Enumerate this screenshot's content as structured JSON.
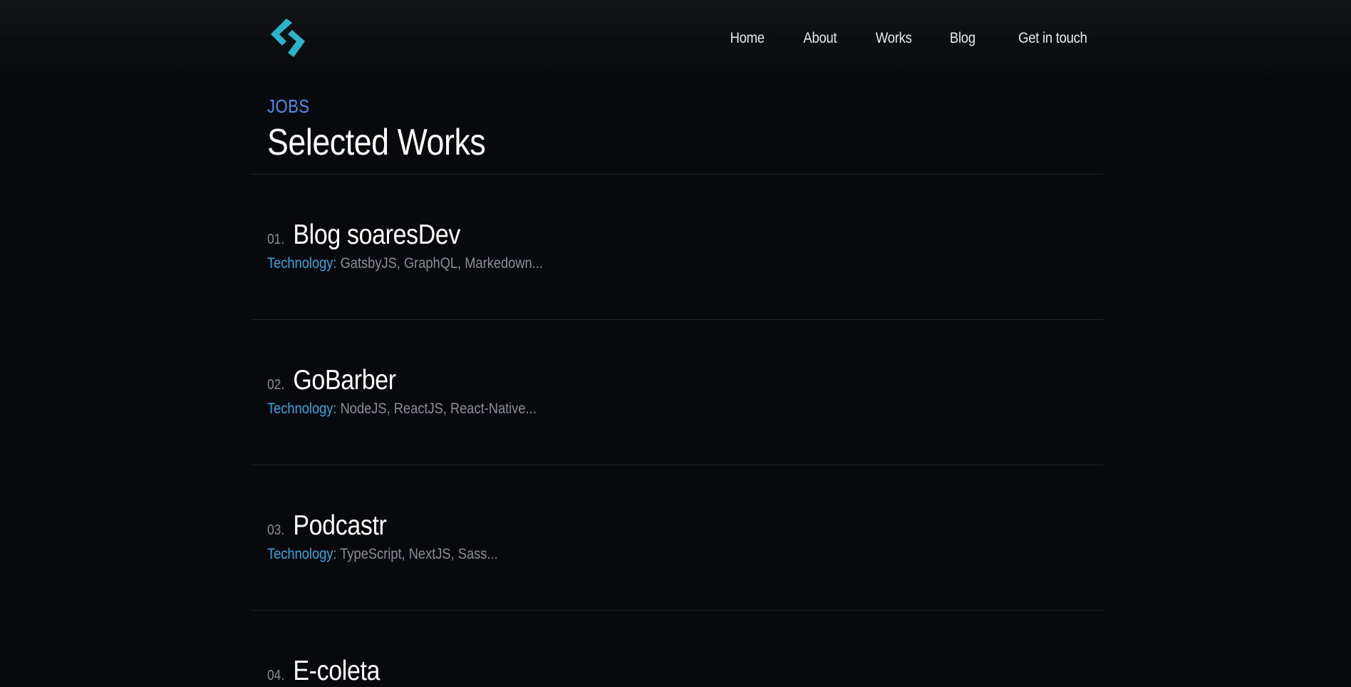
{
  "header": {
    "logo_icon": "code-chevrons-icon",
    "accent": "#2cb3cc",
    "nav": [
      "Home",
      "About",
      "Works",
      "Blog",
      "Get in touch"
    ]
  },
  "section": {
    "eyebrow": "JOBS",
    "title": "Selected Works",
    "eyebrow_color": "#4f8fe8"
  },
  "works": [
    {
      "number": "01.",
      "title": "Blog soaresDev",
      "tech_label": "Technology:",
      "tech": "GatsbyJS, GraphQL, Markedown..."
    },
    {
      "number": "02.",
      "title": "GoBarber",
      "tech_label": "Technology:",
      "tech": "NodeJS, ReactJS, React-Native..."
    },
    {
      "number": "03.",
      "title": "Podcastr",
      "tech_label": "Technology:",
      "tech": "TypeScript, NextJS, Sass..."
    },
    {
      "number": "04.",
      "title": "E-coleta",
      "tech_label": "",
      "tech": ""
    }
  ]
}
